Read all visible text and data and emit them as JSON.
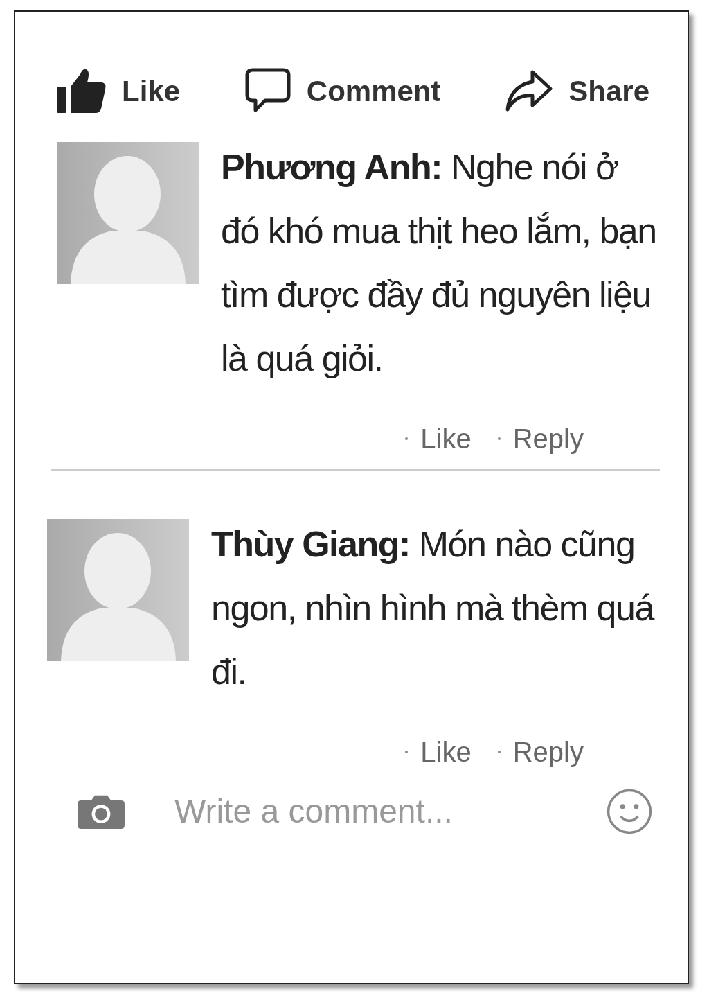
{
  "actions": [
    {
      "kind": "like",
      "label": "Like"
    },
    {
      "kind": "comment",
      "label": "Comment"
    },
    {
      "kind": "share",
      "label": "Share"
    }
  ],
  "comments": [
    {
      "text": "**Phương Anh:** Nghe nói ở đó khó mua thịt heo lắm, bạn tìm được đầy đủ nguyên liệu là quá giỏi.",
      "links": [
        "Like",
        "Reply"
      ]
    },
    {
      "text": "**Thùy Giang:** Món nào cũng ngon, nhìn hình mà thèm quá đi.",
      "links": [
        "Like",
        "Reply"
      ]
    }
  ],
  "composer": {
    "placeholder": "Write a comment..."
  }
}
